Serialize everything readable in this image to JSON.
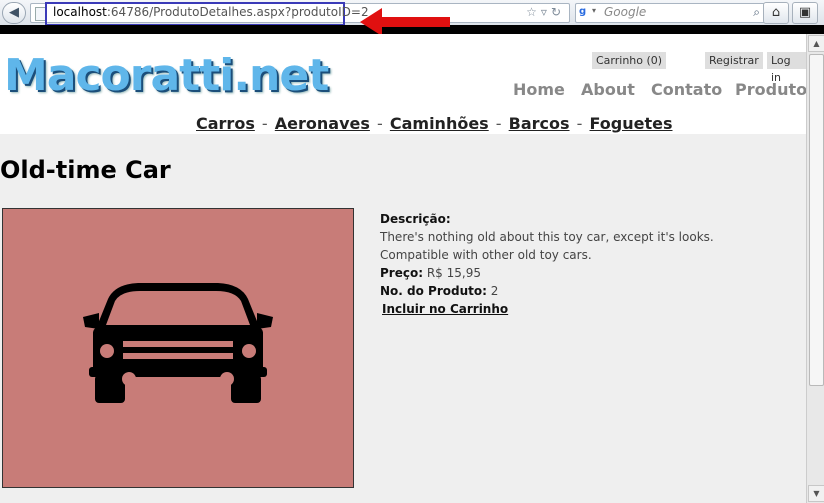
{
  "browser": {
    "url_host": "localhost",
    "url_path": ":64786/ProdutoDetalhes.aspx?produtoID=2",
    "search_placeholder": "Google",
    "back_icon": "back-arrow-icon",
    "search_engine_icon": "google-icon",
    "home_icon": "home-icon",
    "bookmark_icon": "bookmark-icon"
  },
  "header": {
    "logo_text": "Macoratti.net",
    "cart": "Carrinho (0)",
    "register": "Registrar",
    "login": "Log in",
    "nav": [
      "Home",
      "About",
      "Contato",
      "Produtos"
    ]
  },
  "categories": [
    "Carros",
    "Aeronaves",
    "Caminhões",
    "Barcos",
    "Foguetes"
  ],
  "product": {
    "name": "Old-time Car",
    "description_label": "Descrição:",
    "description": "There's nothing old about this toy car, except it's looks. Compatible with other old toy cars.",
    "price_label": "Preço:",
    "price": "R$ 15,95",
    "number_label": "No. do Produto:",
    "number": "2",
    "add_to_cart": "Incluir no Carrinho",
    "image_icon": "car-icon",
    "image_bg": "#c87c78"
  },
  "colors": {
    "annotation_arrow": "#e01010",
    "url_highlight": "#3a3ab8",
    "logo": "#5fb6ea"
  }
}
